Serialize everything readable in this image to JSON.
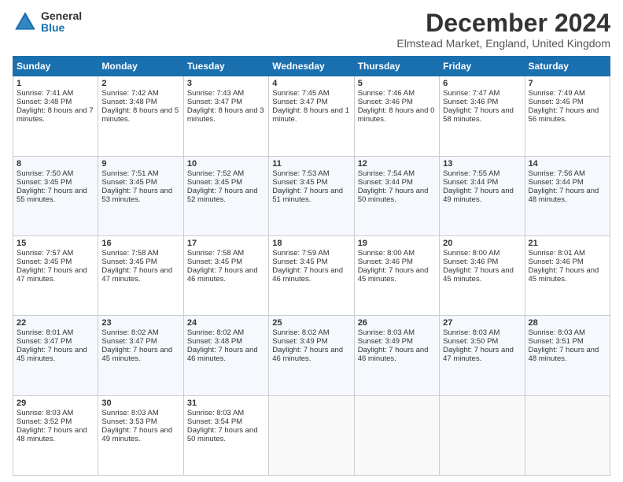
{
  "logo": {
    "general": "General",
    "blue": "Blue"
  },
  "header": {
    "title": "December 2024",
    "subtitle": "Elmstead Market, England, United Kingdom"
  },
  "weekdays": [
    "Sunday",
    "Monday",
    "Tuesday",
    "Wednesday",
    "Thursday",
    "Friday",
    "Saturday"
  ],
  "weeks": [
    [
      {
        "day": "1",
        "sunrise": "Sunrise: 7:41 AM",
        "sunset": "Sunset: 3:48 PM",
        "daylight": "Daylight: 8 hours and 7 minutes."
      },
      {
        "day": "2",
        "sunrise": "Sunrise: 7:42 AM",
        "sunset": "Sunset: 3:48 PM",
        "daylight": "Daylight: 8 hours and 5 minutes."
      },
      {
        "day": "3",
        "sunrise": "Sunrise: 7:43 AM",
        "sunset": "Sunset: 3:47 PM",
        "daylight": "Daylight: 8 hours and 3 minutes."
      },
      {
        "day": "4",
        "sunrise": "Sunrise: 7:45 AM",
        "sunset": "Sunset: 3:47 PM",
        "daylight": "Daylight: 8 hours and 1 minute."
      },
      {
        "day": "5",
        "sunrise": "Sunrise: 7:46 AM",
        "sunset": "Sunset: 3:46 PM",
        "daylight": "Daylight: 8 hours and 0 minutes."
      },
      {
        "day": "6",
        "sunrise": "Sunrise: 7:47 AM",
        "sunset": "Sunset: 3:46 PM",
        "daylight": "Daylight: 7 hours and 58 minutes."
      },
      {
        "day": "7",
        "sunrise": "Sunrise: 7:49 AM",
        "sunset": "Sunset: 3:45 PM",
        "daylight": "Daylight: 7 hours and 56 minutes."
      }
    ],
    [
      {
        "day": "8",
        "sunrise": "Sunrise: 7:50 AM",
        "sunset": "Sunset: 3:45 PM",
        "daylight": "Daylight: 7 hours and 55 minutes."
      },
      {
        "day": "9",
        "sunrise": "Sunrise: 7:51 AM",
        "sunset": "Sunset: 3:45 PM",
        "daylight": "Daylight: 7 hours and 53 minutes."
      },
      {
        "day": "10",
        "sunrise": "Sunrise: 7:52 AM",
        "sunset": "Sunset: 3:45 PM",
        "daylight": "Daylight: 7 hours and 52 minutes."
      },
      {
        "day": "11",
        "sunrise": "Sunrise: 7:53 AM",
        "sunset": "Sunset: 3:45 PM",
        "daylight": "Daylight: 7 hours and 51 minutes."
      },
      {
        "day": "12",
        "sunrise": "Sunrise: 7:54 AM",
        "sunset": "Sunset: 3:44 PM",
        "daylight": "Daylight: 7 hours and 50 minutes."
      },
      {
        "day": "13",
        "sunrise": "Sunrise: 7:55 AM",
        "sunset": "Sunset: 3:44 PM",
        "daylight": "Daylight: 7 hours and 49 minutes."
      },
      {
        "day": "14",
        "sunrise": "Sunrise: 7:56 AM",
        "sunset": "Sunset: 3:44 PM",
        "daylight": "Daylight: 7 hours and 48 minutes."
      }
    ],
    [
      {
        "day": "15",
        "sunrise": "Sunrise: 7:57 AM",
        "sunset": "Sunset: 3:45 PM",
        "daylight": "Daylight: 7 hours and 47 minutes."
      },
      {
        "day": "16",
        "sunrise": "Sunrise: 7:58 AM",
        "sunset": "Sunset: 3:45 PM",
        "daylight": "Daylight: 7 hours and 47 minutes."
      },
      {
        "day": "17",
        "sunrise": "Sunrise: 7:58 AM",
        "sunset": "Sunset: 3:45 PM",
        "daylight": "Daylight: 7 hours and 46 minutes."
      },
      {
        "day": "18",
        "sunrise": "Sunrise: 7:59 AM",
        "sunset": "Sunset: 3:45 PM",
        "daylight": "Daylight: 7 hours and 46 minutes."
      },
      {
        "day": "19",
        "sunrise": "Sunrise: 8:00 AM",
        "sunset": "Sunset: 3:46 PM",
        "daylight": "Daylight: 7 hours and 45 minutes."
      },
      {
        "day": "20",
        "sunrise": "Sunrise: 8:00 AM",
        "sunset": "Sunset: 3:46 PM",
        "daylight": "Daylight: 7 hours and 45 minutes."
      },
      {
        "day": "21",
        "sunrise": "Sunrise: 8:01 AM",
        "sunset": "Sunset: 3:46 PM",
        "daylight": "Daylight: 7 hours and 45 minutes."
      }
    ],
    [
      {
        "day": "22",
        "sunrise": "Sunrise: 8:01 AM",
        "sunset": "Sunset: 3:47 PM",
        "daylight": "Daylight: 7 hours and 45 minutes."
      },
      {
        "day": "23",
        "sunrise": "Sunrise: 8:02 AM",
        "sunset": "Sunset: 3:47 PM",
        "daylight": "Daylight: 7 hours and 45 minutes."
      },
      {
        "day": "24",
        "sunrise": "Sunrise: 8:02 AM",
        "sunset": "Sunset: 3:48 PM",
        "daylight": "Daylight: 7 hours and 46 minutes."
      },
      {
        "day": "25",
        "sunrise": "Sunrise: 8:02 AM",
        "sunset": "Sunset: 3:49 PM",
        "daylight": "Daylight: 7 hours and 46 minutes."
      },
      {
        "day": "26",
        "sunrise": "Sunrise: 8:03 AM",
        "sunset": "Sunset: 3:49 PM",
        "daylight": "Daylight: 7 hours and 46 minutes."
      },
      {
        "day": "27",
        "sunrise": "Sunrise: 8:03 AM",
        "sunset": "Sunset: 3:50 PM",
        "daylight": "Daylight: 7 hours and 47 minutes."
      },
      {
        "day": "28",
        "sunrise": "Sunrise: 8:03 AM",
        "sunset": "Sunset: 3:51 PM",
        "daylight": "Daylight: 7 hours and 48 minutes."
      }
    ],
    [
      {
        "day": "29",
        "sunrise": "Sunrise: 8:03 AM",
        "sunset": "Sunset: 3:52 PM",
        "daylight": "Daylight: 7 hours and 48 minutes."
      },
      {
        "day": "30",
        "sunrise": "Sunrise: 8:03 AM",
        "sunset": "Sunset: 3:53 PM",
        "daylight": "Daylight: 7 hours and 49 minutes."
      },
      {
        "day": "31",
        "sunrise": "Sunrise: 8:03 AM",
        "sunset": "Sunset: 3:54 PM",
        "daylight": "Daylight: 7 hours and 50 minutes."
      },
      null,
      null,
      null,
      null
    ]
  ]
}
